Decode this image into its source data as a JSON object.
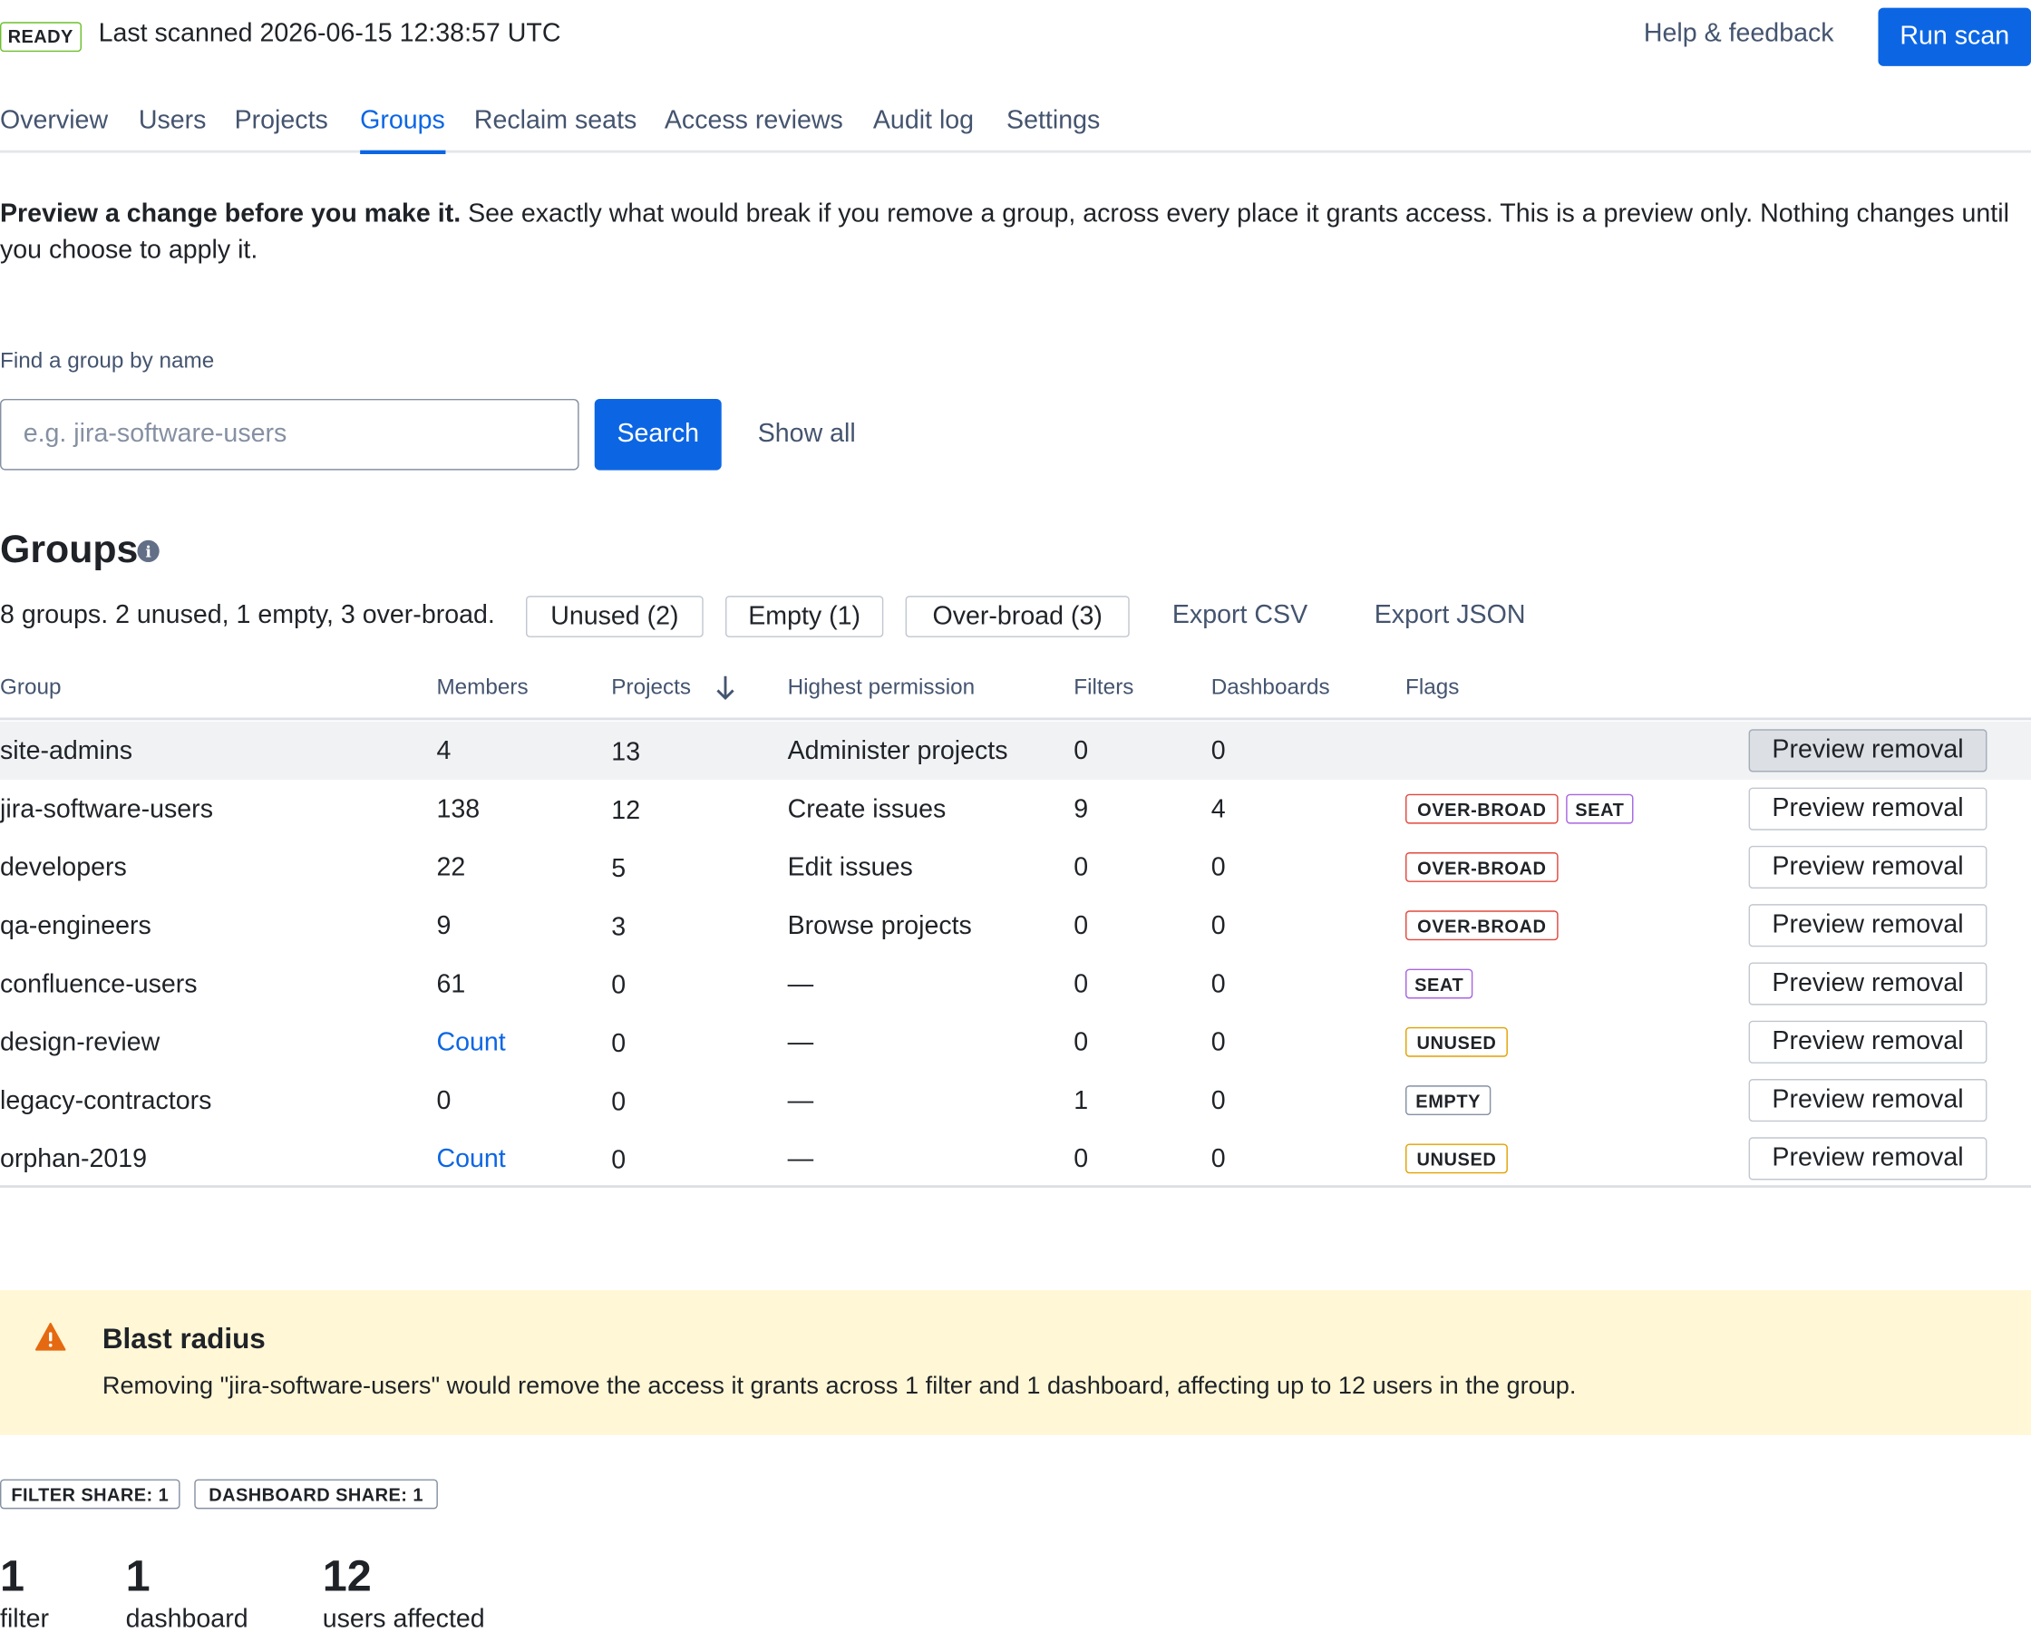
{
  "header": {
    "status": "READY",
    "last_scanned": "Last scanned 2026-06-15 12:38:57 UTC",
    "help_label": "Help & feedback",
    "run_scan_label": "Run scan"
  },
  "tabs": [
    {
      "label": "Overview",
      "active": false
    },
    {
      "label": "Users",
      "active": false
    },
    {
      "label": "Projects",
      "active": false
    },
    {
      "label": "Groups",
      "active": true
    },
    {
      "label": "Reclaim seats",
      "active": false
    },
    {
      "label": "Access reviews",
      "active": false
    },
    {
      "label": "Audit log",
      "active": false
    },
    {
      "label": "Settings",
      "active": false
    }
  ],
  "intro": {
    "lead": "Preview a change before you make it.",
    "text": " See exactly what would break if you remove a group, across every place it grants access. This is a preview only. Nothing changes until you choose to apply it."
  },
  "search": {
    "label": "Find a group by name",
    "placeholder": "e.g. jira-software-users",
    "value": "",
    "button_label": "Search",
    "show_all_label": "Show all"
  },
  "groups": {
    "title": "Groups",
    "info_icon": "info-icon",
    "summary": "8 groups. 2 unused, 1 empty, 3 over-broad.",
    "filters": [
      "Unused (2)",
      "Empty (1)",
      "Over-broad (3)"
    ],
    "export_csv": "Export CSV",
    "export_json": "Export JSON",
    "columns": [
      "Group",
      "Members",
      "Projects",
      "Highest permission",
      "Filters",
      "Dashboards",
      "Flags"
    ],
    "sort_icon": "arrow-down-icon",
    "action_label": "Preview removal",
    "rows": [
      {
        "group": "site-admins",
        "members": "4",
        "members_link": false,
        "projects": "13",
        "permission": "Administer projects",
        "filters": "0",
        "dashboards": "0",
        "flags": [],
        "highlight": true
      },
      {
        "group": "jira-software-users",
        "members": "138",
        "members_link": false,
        "projects": "12",
        "permission": "Create issues",
        "filters": "9",
        "dashboards": "4",
        "flags": [
          {
            "label": "OVER-BROAD",
            "kind": "over"
          },
          {
            "label": "SEAT",
            "kind": "seat"
          }
        ],
        "highlight": false
      },
      {
        "group": "developers",
        "members": "22",
        "members_link": false,
        "projects": "5",
        "permission": "Edit issues",
        "filters": "0",
        "dashboards": "0",
        "flags": [
          {
            "label": "OVER-BROAD",
            "kind": "over"
          }
        ],
        "highlight": false
      },
      {
        "group": "qa-engineers",
        "members": "9",
        "members_link": false,
        "projects": "3",
        "permission": "Browse projects",
        "filters": "0",
        "dashboards": "0",
        "flags": [
          {
            "label": "OVER-BROAD",
            "kind": "over"
          }
        ],
        "highlight": false
      },
      {
        "group": "confluence-users",
        "members": "61",
        "members_link": false,
        "projects": "0",
        "permission": "—",
        "filters": "0",
        "dashboards": "0",
        "flags": [
          {
            "label": "SEAT",
            "kind": "seat"
          }
        ],
        "highlight": false
      },
      {
        "group": "design-review",
        "members": "Count",
        "members_link": true,
        "projects": "0",
        "permission": "—",
        "filters": "0",
        "dashboards": "0",
        "flags": [
          {
            "label": "UNUSED",
            "kind": "unused"
          }
        ],
        "highlight": false
      },
      {
        "group": "legacy-contractors",
        "members": "0",
        "members_link": false,
        "projects": "0",
        "permission": "—",
        "filters": "1",
        "dashboards": "0",
        "flags": [
          {
            "label": "EMPTY",
            "kind": "empty"
          }
        ],
        "highlight": false
      },
      {
        "group": "orphan-2019",
        "members": "Count",
        "members_link": true,
        "projects": "0",
        "permission": "—",
        "filters": "0",
        "dashboards": "0",
        "flags": [
          {
            "label": "UNUSED",
            "kind": "unused"
          }
        ],
        "highlight": false
      }
    ]
  },
  "blast": {
    "icon": "warning-icon",
    "title": "Blast radius",
    "text": "Removing \"jira-software-users\" would remove the access it grants across 1 filter and 1 dashboard, affecting up to 12 users in the group.",
    "badges": [
      "FILTER SHARE: 1",
      "DASHBOARD SHARE: 1"
    ],
    "stats": [
      {
        "value": "1",
        "label": "filter"
      },
      {
        "value": "1",
        "label": "dashboard"
      },
      {
        "value": "12",
        "label": "users affected"
      }
    ]
  },
  "colors": {
    "accent": "#0C66E4",
    "ready": "#6cbf2c",
    "over_broad": "#e2483d",
    "seat": "#a866e0",
    "unused": "#e2a100",
    "warning_bg": "#fff7d6",
    "warning_icon": "#e56910"
  }
}
